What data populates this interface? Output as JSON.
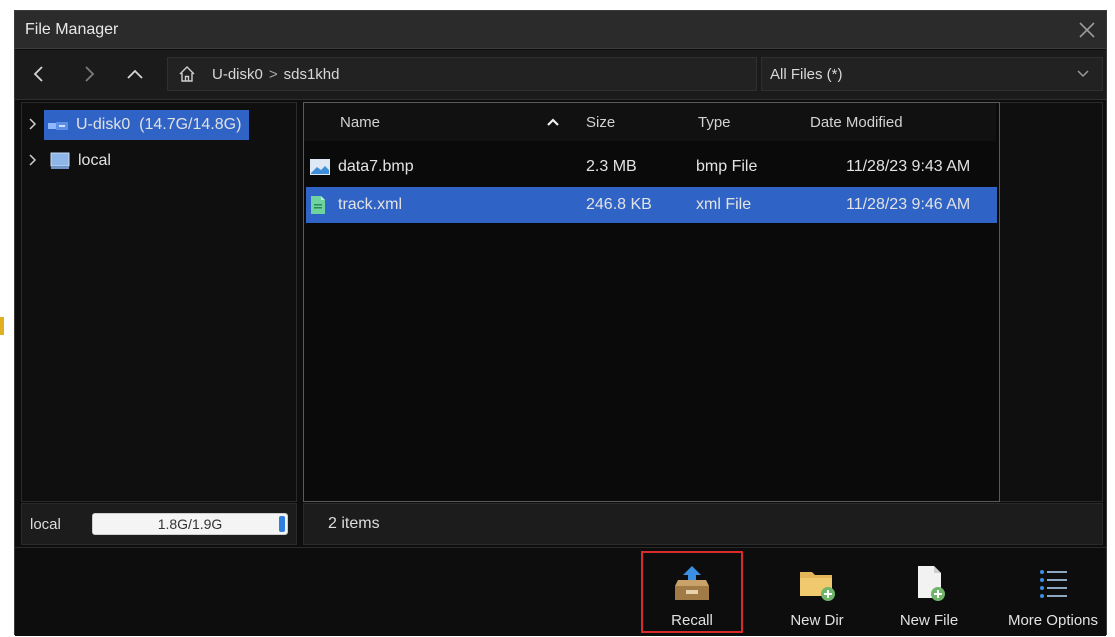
{
  "window": {
    "title": "File Manager"
  },
  "nav": {
    "path": [
      "U-disk0",
      "sds1khd"
    ],
    "path_sep": ">",
    "filter": "All Files (*)"
  },
  "tree": {
    "items": [
      {
        "label": "U-disk0  (14.7G/14.8G)",
        "selected": true
      },
      {
        "label": "local",
        "selected": false
      }
    ]
  },
  "storage": {
    "label": "local",
    "usage": "1.8G/1.9G",
    "used_fraction": 0.95
  },
  "table": {
    "columns": {
      "name": "Name",
      "size": "Size",
      "type": "Type",
      "date": "Date Modified"
    },
    "rows": [
      {
        "name": "data7.bmp",
        "size": "2.3 MB",
        "type": "bmp File",
        "date": "11/28/23 9:43 AM",
        "selected": false
      },
      {
        "name": "track.xml",
        "size": "246.8 KB",
        "type": "xml File",
        "date": "11/28/23 9:46 AM",
        "selected": true
      }
    ]
  },
  "status": {
    "count": "2 items"
  },
  "toolbar": {
    "recall": "Recall",
    "new_dir": "New Dir",
    "new_file": "New File",
    "more_options": "More Options"
  },
  "colors": {
    "selection": "#2f63c6",
    "highlight_frame": "#d92b2b",
    "background": "#0d0d0d"
  }
}
